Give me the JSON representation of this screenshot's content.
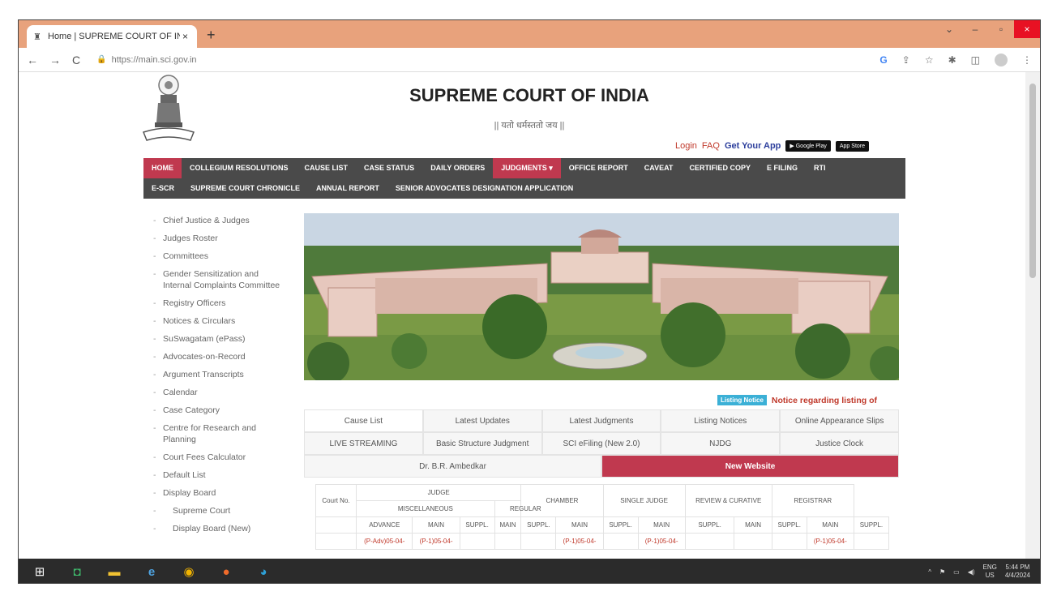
{
  "browser": {
    "tab_title": "Home | SUPREME COURT OF INI",
    "tab_close": "×",
    "new_tab": "+",
    "url": "https://main.sci.gov.in",
    "minimize": "–",
    "maximize": "▫",
    "close": "×"
  },
  "header": {
    "title": "SUPREME COURT OF INDIA",
    "motto": "|| यतो धर्मस्ततो जय ||",
    "login": "Login",
    "faq": "FAQ",
    "get_app": "Get Your App",
    "google_play": "▶ Google Play",
    "app_store": " App Store"
  },
  "menu": {
    "row1": [
      "HOME",
      "COLLEGIUM RESOLUTIONS",
      "CAUSE LIST",
      "CASE STATUS",
      "DAILY ORDERS",
      "JUDGMENTS ▾",
      "OFFICE REPORT",
      "CAVEAT",
      "CERTIFIED COPY",
      "E FILING",
      "RTI"
    ],
    "row2": [
      "E-SCR",
      "SUPREME COURT CHRONICLE",
      "ANNUAL REPORT",
      "SENIOR ADVOCATES DESIGNATION APPLICATION"
    ]
  },
  "sidebar": [
    "Chief Justice & Judges",
    "Judges Roster",
    "Committees",
    "Gender Sensitization and Internal Complaints Committee",
    "Registry Officers",
    "Notices & Circulars",
    "SuSwagatam (ePass)",
    "Advocates-on-Record",
    "Argument Transcripts",
    "Calendar",
    "Case Category",
    "Centre for Research and Planning",
    "Court Fees Calculator",
    "Default List",
    "Display Board",
    "Supreme Court",
    "Display Board (New)"
  ],
  "notice": {
    "badge": "Listing Notice",
    "text": "Notice regarding listing of"
  },
  "tabs": {
    "row1": [
      "Cause List",
      "Latest Updates",
      "Latest Judgments",
      "Listing Notices",
      "Online Appearance Slips"
    ],
    "row2": [
      "LIVE STREAMING",
      "Basic Structure Judgment",
      "SCI eFiling (New 2.0)",
      "NJDG",
      "Justice Clock"
    ],
    "row3": [
      "Dr. B.R. Ambedkar",
      "New Website"
    ]
  },
  "display_table": {
    "court_no": "Court No.",
    "judge": "JUDGE",
    "miscellaneous": "MISCELLANEOUS",
    "regular": "REGULAR",
    "chamber": "CHAMBER",
    "single_judge": "SINGLE JUDGE",
    "review": "REVIEW & CURATIVE",
    "registrar": "REGISTRAR",
    "sub": [
      "ADVANCE",
      "MAIN",
      "SUPPL.",
      "MAIN",
      "SUPPL.",
      "MAIN",
      "SUPPL.",
      "MAIN",
      "SUPPL.",
      "MAIN",
      "SUPPL.",
      "MAIN",
      "SUPPL."
    ],
    "row": [
      "",
      "(P-Adv)05-04-",
      "(P-1)05-04-",
      "",
      "",
      "",
      "(P-1)05-04-",
      "",
      "(P-1)05-04-",
      "",
      "",
      "",
      "(P-1)05-04-",
      ""
    ]
  },
  "taskbar": {
    "lang": "ENG",
    "region": "US",
    "time": "5:44 PM",
    "date": "4/4/2024"
  },
  "colors": {
    "accent": "#c0394f",
    "menu_bg": "#4a4a4a",
    "browser_tabstrip": "#e8a27c"
  }
}
